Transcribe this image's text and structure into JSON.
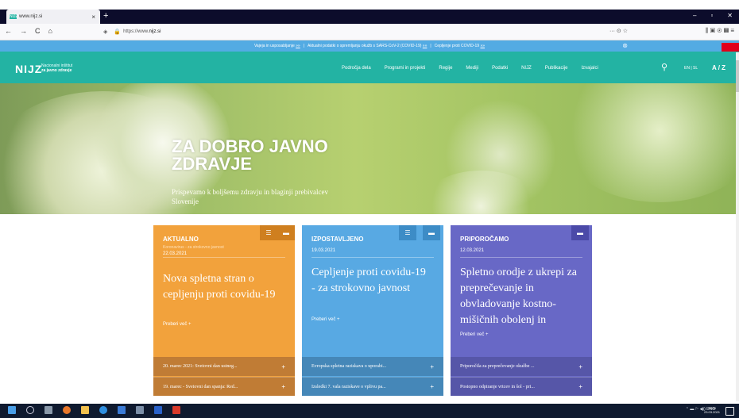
{
  "browser": {
    "tab_title": "www.nijz.si",
    "tab_favicon": "NIJZ",
    "url_prefix": "https://www.",
    "url_domain": "nijz.si",
    "new_tab_icon": "+",
    "nav": {
      "back": "←",
      "forward": "→",
      "reload": "C",
      "home": "⌂"
    },
    "url_actions": "··· ⊙ ☆",
    "toolbar": "⫼ ▣ ⊛ ▦ ≡",
    "window_buttons": {
      "min": "–",
      "max": "▫",
      "close": "✕"
    }
  },
  "notice": {
    "item1": "Vajeja in usposabljanje",
    "item2": "Aktualni podatki o spremljanju okužb s SARS-CoV-2 (COVID-19)",
    "item3": "Cepljenje proti COVID-19",
    "link": "»»",
    "sep": "|"
  },
  "header": {
    "logo": "NIJZ",
    "logo_sub1": "Nacionalni inštitut",
    "logo_sub2": "za javno zdravje",
    "menu": [
      "Področja dela",
      "Programi in projekti",
      "Regije",
      "Mediji",
      "Podatki",
      "NIJZ",
      "Publikacije",
      "Izvajalci"
    ],
    "lang": "EN | SL",
    "az": "A / Z"
  },
  "hero": {
    "title": "ZA DOBRO JAVNO ZDRAVJE",
    "subtitle": "Prispevamo k boljšemu zdravju in blaginji prebivalcev Slovenije"
  },
  "cards": [
    {
      "category": "AKTUALNO",
      "crumb": "Koronavirus - za strokovno javnost",
      "date": "22.03.2021",
      "headline": "Nova spletna stran o cepljenju proti covidu-19",
      "more": "Preberi več",
      "links": [
        "20. marec 2021: Svetovni dan ustneg...",
        "19. marec - Svetovni dan spanja: Red..."
      ]
    },
    {
      "category": "IZPOSTAVLJENO",
      "date": "19.03.2021",
      "headline": "Cepljenje proti covidu-19 - za strokovno javnost",
      "more": "Preberi več",
      "links": [
        "Evropska spletna raziskava o uporabi...",
        "Izsledki 7. vala raziskave o vplivu pa..."
      ]
    },
    {
      "category": "PRIPOROČAMO",
      "date": "12.03.2021",
      "headline": "Spletno orodje z ukrepi za preprečevanje in obvladovanje kostno-mišičnih obolenj in",
      "more": "Preberi več",
      "links": [
        "Priporočila za preprečevanje okužbe ...",
        "Postopno odpiranje vrtcev in šol - pri..."
      ]
    }
  ],
  "icons": {
    "rss": "☰",
    "folder": "▬",
    "plus": "+",
    "search": "⚲"
  },
  "taskbar": {
    "tray": "⌃ ▬ ⚐ ◀)) ENG",
    "time": "19:26",
    "date": "23.03.2021"
  }
}
